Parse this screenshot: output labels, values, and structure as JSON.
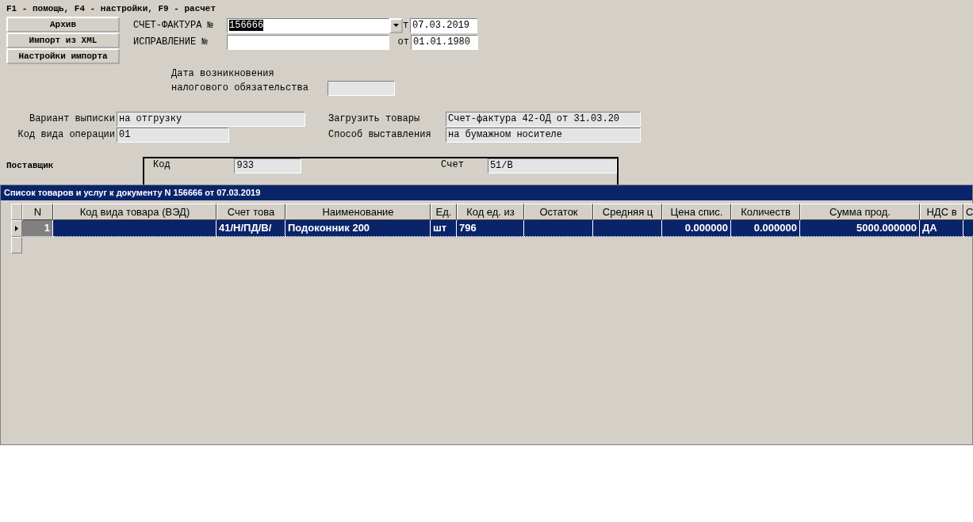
{
  "hotkeys": "F1 - помощь, F4 - настройки, F9 - расчет",
  "buttons": [
    "Архив",
    "Импорт из XML",
    "Настройки импорта"
  ],
  "invoice": {
    "label": "СЧЕТ-ФАКТУРА №",
    "value": "156666",
    "value_selected": true,
    "from_label": "т",
    "date": "07.03.2019"
  },
  "correction": {
    "label": "ИСПРАВЛЕНИЕ  №",
    "from_label": "от",
    "date": "01.01.1980"
  },
  "tax_date": {
    "label_1": "Дата возникновения",
    "label_2": "налогового обязательства"
  },
  "statement_variant": {
    "label": "Вариант выписки",
    "value": "на отгрузку"
  },
  "operation_code": {
    "label": "Код вида операции",
    "value": "01"
  },
  "load_goods": {
    "label": "Загрузить товары",
    "value": "Счет-фактура 42-ОД от 31.03.20"
  },
  "issue_method": {
    "label": "Способ выставления",
    "value": "на бумажном носителе"
  },
  "supplier": {
    "label": "Поставщик",
    "code_label": "Код",
    "code": "933",
    "account_label": "Счет",
    "account": "51/В"
  },
  "goods_window": {
    "title": "Список товаров и услуг к документу N 156666 от 07.03.2019",
    "columns": [
      "N",
      "Код вида товара (ВЭД)",
      "Счет това",
      "Наименование",
      "Ед.",
      "Код ед. из",
      "Остаток",
      "Средняя ц",
      "Цена спис.",
      "Количеств",
      "Сумма прод.",
      "НДС в",
      "С"
    ],
    "rows": [
      {
        "selected": true,
        "cells": [
          "1",
          "",
          "41/Н/ПД/В/",
          "Подоконник 200",
          "шт",
          "796",
          "",
          "",
          "0.000000",
          "0.000000",
          "5000.000000",
          "ДА",
          ""
        ]
      }
    ]
  }
}
